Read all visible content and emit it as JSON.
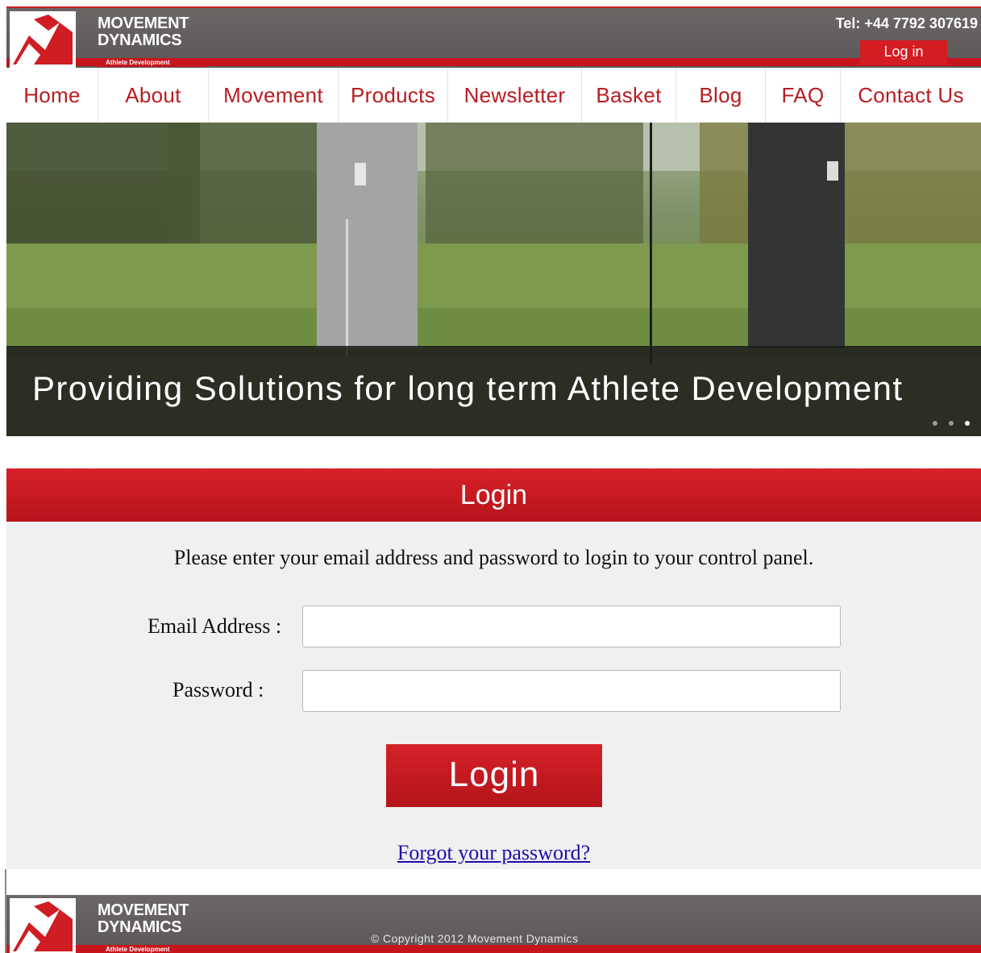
{
  "header": {
    "brand_line1": "MOVEMENT",
    "brand_line2": "DYNAMICS",
    "brand_tag": "Athlete Development",
    "tel": "Tel: +44 7792 307619",
    "login_link": "Log in"
  },
  "nav": {
    "items": [
      {
        "label": "Home"
      },
      {
        "label": "About"
      },
      {
        "label": "Movement"
      },
      {
        "label": "Products"
      },
      {
        "label": "Newsletter"
      },
      {
        "label": "Basket"
      },
      {
        "label": "Blog"
      },
      {
        "label": "FAQ"
      },
      {
        "label": "Contact Us"
      }
    ]
  },
  "hero": {
    "caption": "Providing Solutions for long term Athlete Development",
    "slides": 3,
    "active_slide": 3
  },
  "login": {
    "title": "Login",
    "intro": "Please enter your email address and password to login to your control panel.",
    "email_label": "Email Address :",
    "email_value": "",
    "password_label": "Password :",
    "password_value": "",
    "submit_label": "Login",
    "forgot_label": "Forgot your password?"
  },
  "footer": {
    "brand_line1": "MOVEMENT",
    "brand_line2": "DYNAMICS",
    "brand_tag": "Athlete Development",
    "copyright": "© Copyright 2012 Movement Dynamics"
  },
  "colors": {
    "brand_red": "#c8141c",
    "header_grey": "#615e5d",
    "panel_bg": "#f0f0f0",
    "link_blue": "#1a0dab"
  },
  "icons": [
    "logo-mark-icon",
    "slide-dot-icon"
  ]
}
